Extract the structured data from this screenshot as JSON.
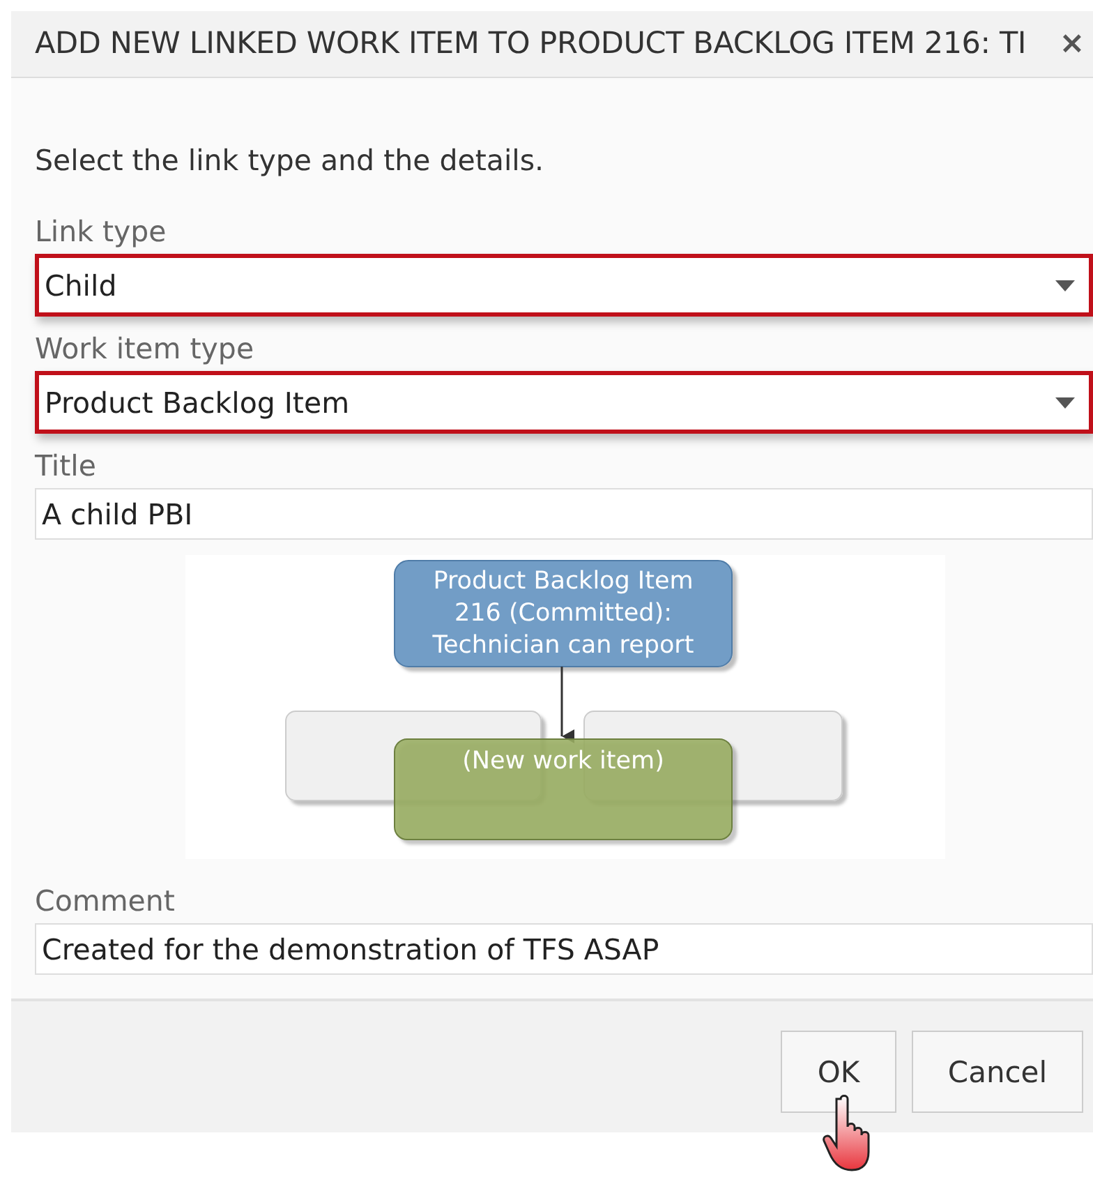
{
  "dialog": {
    "title": "ADD NEW LINKED WORK ITEM TO PRODUCT BACKLOG ITEM 216: TI",
    "close": "×"
  },
  "instruction": "Select the link type and the details.",
  "fields": [
    {
      "kind": "select",
      "label": "Link type",
      "value": "Child",
      "highlighted": true
    },
    {
      "kind": "select",
      "label": "Work item type",
      "value": "Product Backlog Item",
      "highlighted": true
    },
    {
      "kind": "text",
      "label": "Title",
      "value": "A child PBI",
      "highlighted": false
    }
  ],
  "diagram": {
    "parent_lines": [
      "Product Backlog Item",
      "216 (Committed):",
      "Technician can report"
    ],
    "new_item": "(New work item)"
  },
  "comment": {
    "kind": "text",
    "label": "Comment",
    "value": "Created for the demonstration of TFS ASAP",
    "highlighted": false
  },
  "buttons": [
    {
      "label": "OK"
    },
    {
      "label": "Cancel"
    }
  ]
}
